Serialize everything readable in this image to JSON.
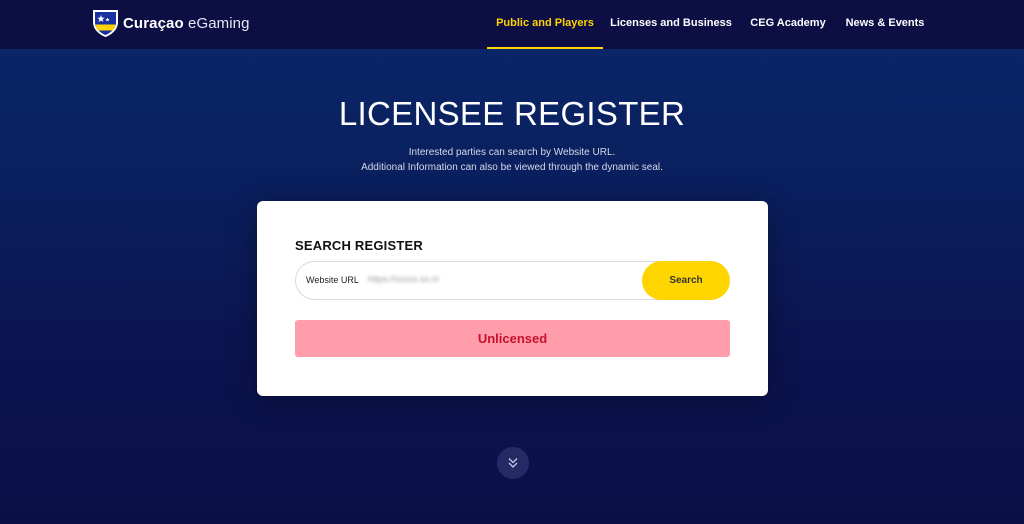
{
  "brand": {
    "name_bold": "Curaçao",
    "name_light": " eGaming",
    "colors": {
      "primary": "#0c0e44",
      "accent": "#ffd400",
      "status_bg": "#ff9dab",
      "status_text": "#c8102e"
    }
  },
  "nav": {
    "items": [
      {
        "label": "Public and Players",
        "active": true
      },
      {
        "label": "Licenses and Business",
        "active": false
      },
      {
        "label": "CEG Academy",
        "active": false
      },
      {
        "label": "News & Events",
        "active": false
      }
    ]
  },
  "hero": {
    "title": "LICENSEE REGISTER",
    "subtitle_line1": "Interested parties can search by Website URL.",
    "subtitle_line2": "Additional Information can also be viewed through the dynamic seal."
  },
  "search": {
    "heading": "SEARCH REGISTER",
    "field_label": "Website URL",
    "field_value": "https://xxxxx.xx.nl",
    "button_label": "Search",
    "result_status": "Unlicensed"
  },
  "icons": {
    "logo": "shield-star-logo-icon",
    "scroll": "double-chevron-down-icon"
  }
}
